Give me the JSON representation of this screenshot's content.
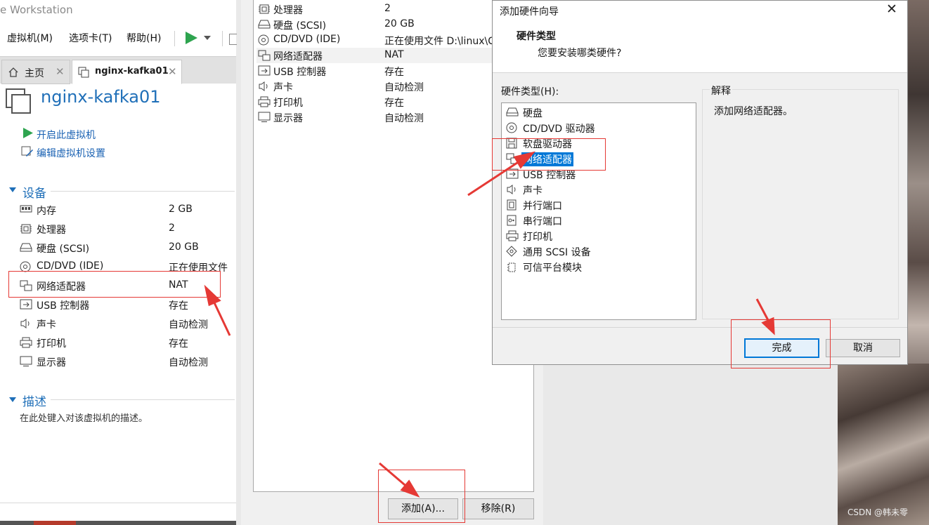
{
  "app": {
    "title": "e Workstation"
  },
  "menu": [
    "虚拟机(M)",
    "选项卡(T)",
    "帮助(H)"
  ],
  "tabs": [
    {
      "label": "主页",
      "close": "✕"
    },
    {
      "label": "nginx-kafka01",
      "close": "✕"
    }
  ],
  "vm": {
    "name": "nginx-kafka01",
    "actions": [
      "开启此虚拟机",
      "编辑虚拟机设置"
    ],
    "devices_heading": "设备",
    "devices": [
      {
        "name": "内存",
        "value": "2 GB",
        "icon": "memory-icon"
      },
      {
        "name": "处理器",
        "value": "2",
        "icon": "cpu-icon"
      },
      {
        "name": "硬盘 (SCSI)",
        "value": "20 GB",
        "icon": "hard-disk-icon"
      },
      {
        "name": "CD/DVD (IDE)",
        "value": "正在使用文件",
        "icon": "cd-icon"
      },
      {
        "name": "网络适配器",
        "value": "NAT",
        "icon": "network-icon"
      },
      {
        "name": "USB 控制器",
        "value": "存在",
        "icon": "usb-icon"
      },
      {
        "name": "声卡",
        "value": "自动检测",
        "icon": "sound-icon"
      },
      {
        "name": "打印机",
        "value": "存在",
        "icon": "printer-icon"
      },
      {
        "name": "显示器",
        "value": "自动检测",
        "icon": "monitor-icon"
      }
    ],
    "description_heading": "描述",
    "description_placeholder": "在此处键入对该虚拟机的描述。"
  },
  "settings": {
    "rows": [
      {
        "name": "处理器",
        "value": "2",
        "icon": "cpu-icon"
      },
      {
        "name": "硬盘 (SCSI)",
        "value": "20 GB",
        "icon": "hard-disk-icon"
      },
      {
        "name": "CD/DVD (IDE)",
        "value": "正在使用文件 D:\\linux\\C",
        "icon": "cd-icon"
      },
      {
        "name": "网络适配器",
        "value": "NAT",
        "icon": "network-icon"
      },
      {
        "name": "USB 控制器",
        "value": "存在",
        "icon": "usb-icon"
      },
      {
        "name": "声卡",
        "value": "自动检测",
        "icon": "sound-icon"
      },
      {
        "name": "打印机",
        "value": "存在",
        "icon": "printer-icon"
      },
      {
        "name": "显示器",
        "value": "自动检测",
        "icon": "monitor-icon"
      }
    ],
    "add_button": "添加(A)...",
    "remove_button": "移除(R)"
  },
  "wizard": {
    "title": "添加硬件向导",
    "close": "✕",
    "heading": "硬件类型",
    "subheading": "您要安装哪类硬件?",
    "list_label": "硬件类型(H):",
    "hardware": [
      {
        "name": "硬盘",
        "icon": "hard-disk-icon"
      },
      {
        "name": "CD/DVD 驱动器",
        "icon": "cd-icon"
      },
      {
        "name": "软盘驱动器",
        "icon": "floppy-icon"
      },
      {
        "name": "网络适配器",
        "icon": "network-icon",
        "selected": true
      },
      {
        "name": "USB 控制器",
        "icon": "usb-icon"
      },
      {
        "name": "声卡",
        "icon": "sound-icon"
      },
      {
        "name": "并行端口",
        "icon": "parallel-port-icon"
      },
      {
        "name": "串行端口",
        "icon": "serial-port-icon"
      },
      {
        "name": "打印机",
        "icon": "printer-icon"
      },
      {
        "name": "通用 SCSI 设备",
        "icon": "scsi-icon"
      },
      {
        "name": "可信平台模块",
        "icon": "tpm-icon"
      }
    ],
    "explain_label": "解释",
    "explain_text": "添加网络适配器。",
    "finish_button": "完成",
    "cancel_button": "取消"
  },
  "watermark": "CSDN @韩未零",
  "colors": {
    "accent": "#1f6fb8",
    "selection": "#0078d7",
    "annotation": "#e53935",
    "play": "#2ea44f"
  }
}
